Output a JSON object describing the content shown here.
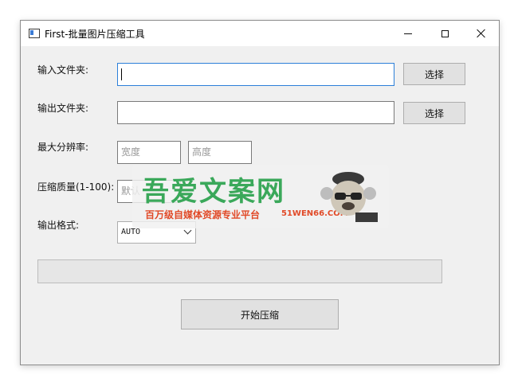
{
  "window": {
    "title": "First-批量图片压缩工具"
  },
  "form": {
    "input_folder_label": "输入文件夹:",
    "input_folder_value": "",
    "input_folder_button": "选择",
    "output_folder_label": "输出文件夹:",
    "output_folder_value": "",
    "output_folder_button": "选择",
    "max_resolution_label": "最大分辨率:",
    "width_placeholder": "宽度",
    "height_placeholder": "高度",
    "quality_label": "压缩质量(1-100):",
    "quality_placeholder": "默认",
    "format_label": "输出格式:",
    "format_selected": "AUTO",
    "progress_fraction": 0,
    "start_button": "开始压缩"
  },
  "watermark": {
    "title": "吾爱文案网",
    "subtitle": "百万级自媒体资源专业平台",
    "url": "51WEN66.COM"
  },
  "colors": {
    "window_bg": "#f0f0f0",
    "focus_border": "#2c7fd9",
    "watermark_green": "#3aa85a",
    "watermark_red": "#e14a28"
  }
}
